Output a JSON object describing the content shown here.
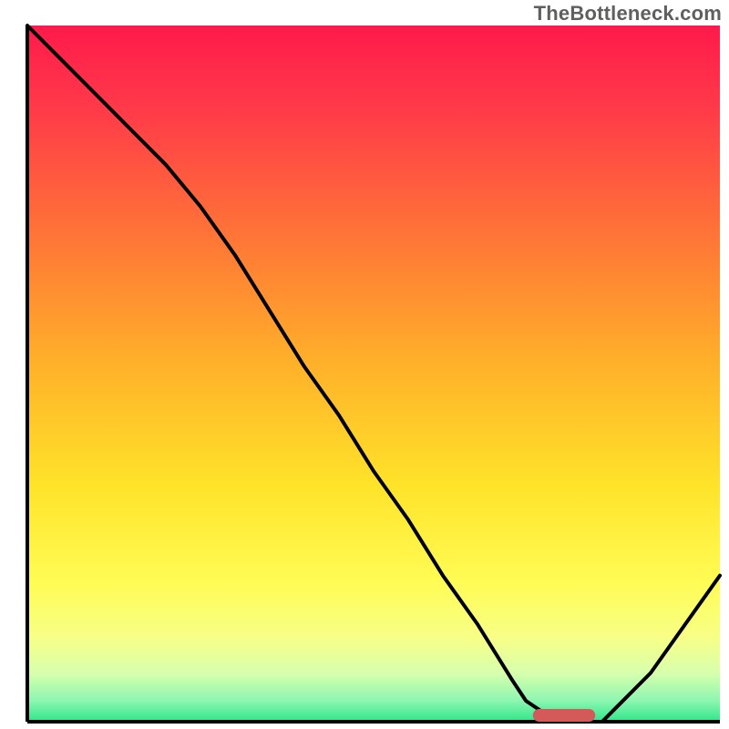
{
  "watermark": "TheBottleneck.com",
  "chart_data": {
    "type": "line",
    "title": "",
    "xlabel": "",
    "ylabel": "",
    "xlim": [
      0,
      100
    ],
    "ylim": [
      0,
      100
    ],
    "x": [
      0,
      5,
      10,
      15,
      20,
      25,
      30,
      35,
      40,
      45,
      50,
      55,
      60,
      65,
      70,
      72,
      75,
      77,
      80,
      83,
      85,
      90,
      95,
      100
    ],
    "y": [
      100,
      95,
      90,
      85,
      80,
      74,
      67,
      59,
      51,
      44,
      36,
      29,
      21,
      14,
      6,
      3,
      1,
      0,
      0,
      0,
      2,
      7,
      14,
      21
    ],
    "optimal_marker": {
      "x_start": 73,
      "x_end": 82,
      "y": 0
    },
    "gradient_stops": [
      {
        "offset": 0.0,
        "color": "#ff1a4b"
      },
      {
        "offset": 0.12,
        "color": "#ff3a49"
      },
      {
        "offset": 0.3,
        "color": "#ff7437"
      },
      {
        "offset": 0.48,
        "color": "#ffaf2a"
      },
      {
        "offset": 0.66,
        "color": "#ffe329"
      },
      {
        "offset": 0.8,
        "color": "#fffc55"
      },
      {
        "offset": 0.88,
        "color": "#f7ff87"
      },
      {
        "offset": 0.93,
        "color": "#d8ffad"
      },
      {
        "offset": 0.97,
        "color": "#8cf6b0"
      },
      {
        "offset": 1.0,
        "color": "#2fe58b"
      }
    ],
    "marker_color": "#d45a5a",
    "line_color": "#000000",
    "axis_color": "#000000"
  }
}
